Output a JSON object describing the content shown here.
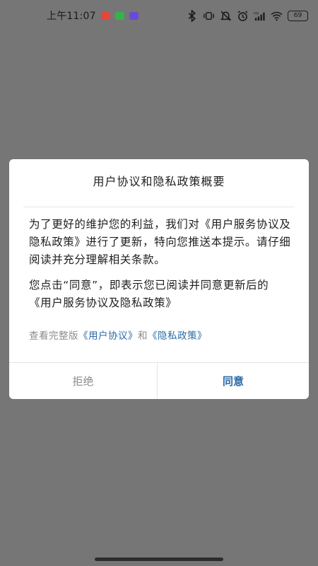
{
  "status_bar": {
    "time": "上午11:07",
    "battery": "69",
    "colors": {
      "badge_red": "#e4463c",
      "badge_green": "#35b24a",
      "badge_purple": "#6a4ad8"
    },
    "icons": [
      "bluetooth-icon",
      "vibrate-icon",
      "mute-icon",
      "alarm-icon",
      "signal-hd-icon",
      "wifi-icon",
      "battery-icon"
    ]
  },
  "dialog": {
    "title": "用户协议和隐私政策概要",
    "paragraph1": "为了更好的维护您的利益，我们对《用户服务协议及隐私政策》进行了更新，特向您推送本提示。请仔细阅读并充分理解相关条款。",
    "paragraph2": "您点击“同意”，即表示您已阅读并同意更新后的 《用户服务协议及隐私政策》",
    "view_prefix": "查看完整版",
    "user_agreement_link": "《用户协议》",
    "conjunction": "和",
    "privacy_link": "《隐私政策》",
    "reject_label": "拒绝",
    "agree_label": "同意",
    "accent_color": "#2a6aa6"
  }
}
